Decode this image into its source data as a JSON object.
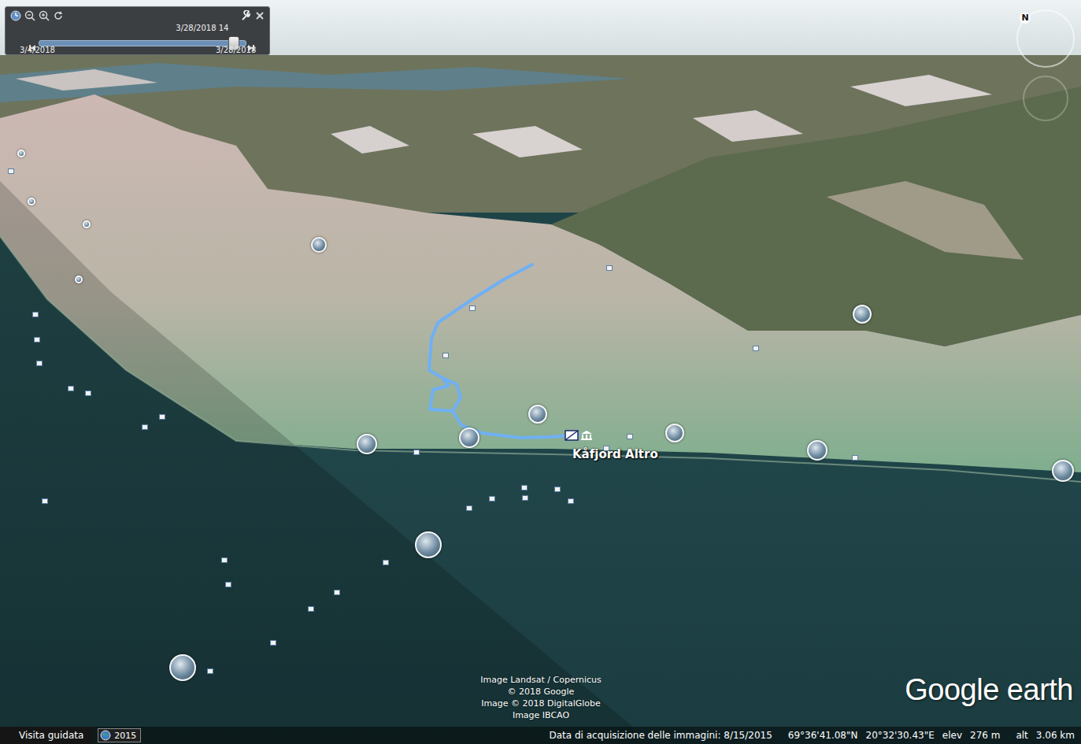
{
  "time_slider": {
    "current": "3/28/2018  14",
    "start": "3/4/2018",
    "end": "3/28/2018",
    "level": 0.94
  },
  "compass": {
    "north": "N"
  },
  "map": {
    "place_label": "Kåfjord Altro",
    "attribution": [
      "Image Landsat / Copernicus",
      "© 2018 Google",
      "Image © 2018 DigitalGlobe",
      "Image IBCAO"
    ],
    "logo": "Google earth"
  },
  "status_bar": {
    "tour_button": "Visita guidata",
    "year": "2015",
    "acquisition_date": "Data di acquisizione delle immagini: 8/15/2015",
    "latitude": "69°36'41.08\"N",
    "longitude": "20°32'30.43\"E",
    "elev_label": "elev",
    "elev": "276 m",
    "alt_label": "alt",
    "alt": "3.06 km"
  }
}
